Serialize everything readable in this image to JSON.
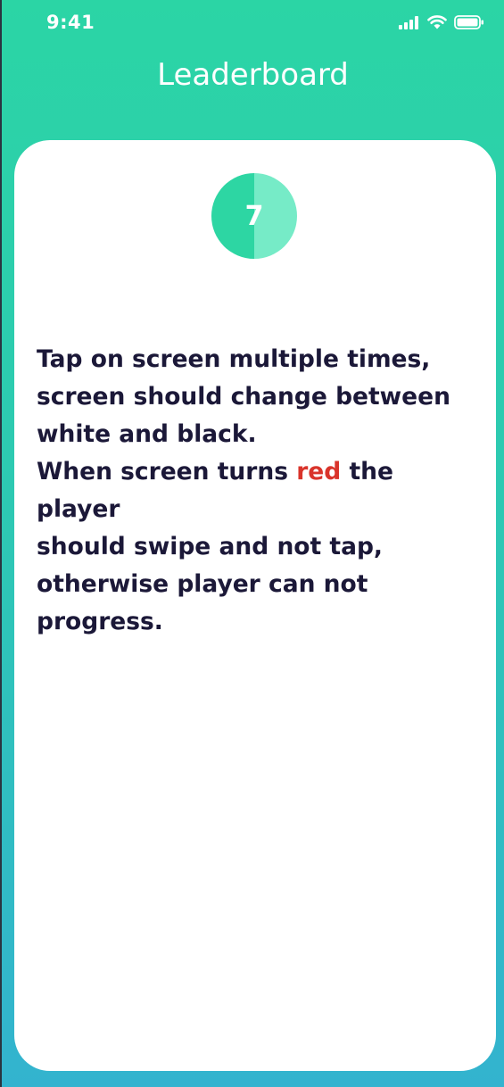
{
  "status_bar": {
    "time": "9:41",
    "icons": [
      "signal-icon",
      "wifi-icon",
      "battery-icon"
    ]
  },
  "header": {
    "title": "Leaderboard"
  },
  "timer": {
    "value": "7",
    "progress": 0.5,
    "colors": {
      "elapsed": "#2dd6a3",
      "remaining": "#76ebc7"
    }
  },
  "instructions": {
    "line1": "Tap on screen multiple times,",
    "line2": "screen should change between",
    "line3": "white and black.",
    "line4_before": "When screen turns ",
    "line4_highlight": "red",
    "line4_after": " the player",
    "line5": "should swipe and not tap,",
    "line6": "otherwise player can not",
    "line7": "progress."
  },
  "colors": {
    "gradient_top": "#2bd5a5",
    "gradient_bottom": "#33b3cf",
    "text": "#1b1838",
    "highlight": "#d9342b"
  }
}
